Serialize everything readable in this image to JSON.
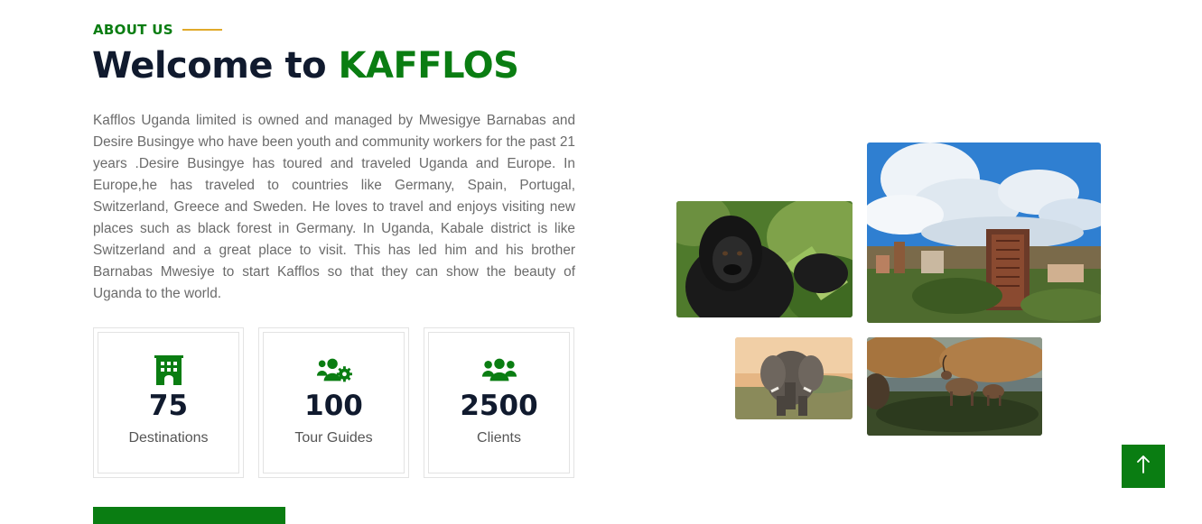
{
  "about": {
    "eyebrow": "ABOUT US",
    "title_prefix": "Welcome to ",
    "title_brand": "KAFFLOS",
    "description": "Kafflos Uganda limited is owned and managed by Mwesigye Barnabas and Desire Busingye who have been youth and community workers for the past 21 years .Desire Busingye has toured and traveled Uganda and Europe. In Europe,he has traveled to countries like Germany, Spain, Portugal, Switzerland, Greece and Sweden. He loves to travel and enjoys visiting new places such as black forest in Germany. In Uganda, Kabale district is like Switzerland and a great place to visit. This has led him and his brother Barnabas Mwesiye to start Kafflos so that they can show the beauty of Uganda to the world."
  },
  "stats": [
    {
      "icon": "building-icon",
      "value": "75",
      "label": "Destinations"
    },
    {
      "icon": "users-cog-icon",
      "value": "100",
      "label": "Tour Guides"
    },
    {
      "icon": "users-icon",
      "value": "2500",
      "label": "Clients"
    }
  ],
  "gallery": [
    {
      "name": "gorilla-photo"
    },
    {
      "name": "kampala-city-photo"
    },
    {
      "name": "elephant-photo"
    },
    {
      "name": "antelope-photo"
    }
  ],
  "scroll_top": {
    "icon": "arrow-up-icon"
  },
  "colors": {
    "brand_green": "#0a7d12",
    "accent_gold": "#e0a92a",
    "heading_dark": "#101a2e"
  }
}
